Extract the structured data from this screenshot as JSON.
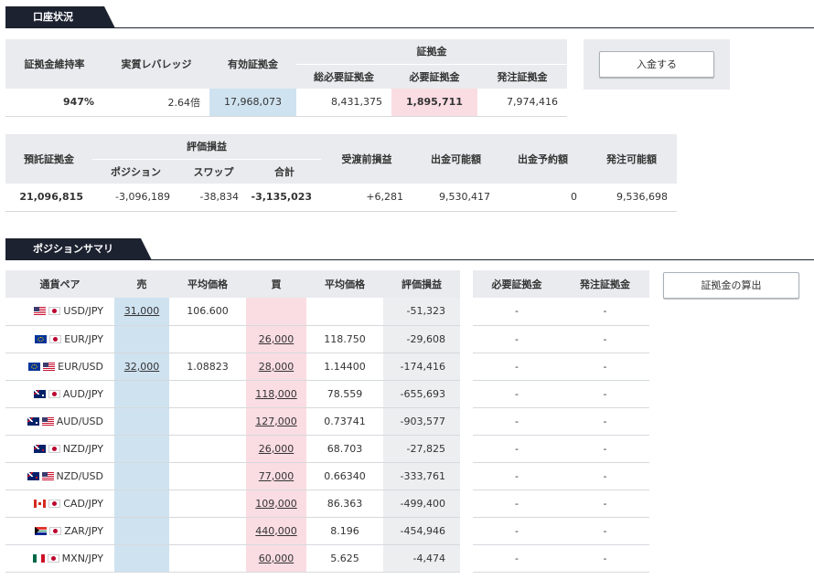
{
  "account": {
    "title": "口座状況",
    "deposit_button": "入金する",
    "table1": {
      "h_margin_ratio": "証拠金維持率",
      "h_leverage": "実質レバレッジ",
      "h_effective": "有効証拠金",
      "h_margin_group": "証拠金",
      "h_total_required": "総必要証拠金",
      "h_required": "必要証拠金",
      "h_order": "発注証拠金",
      "margin_ratio": "947%",
      "leverage": "2.64倍",
      "effective": "17,968,073",
      "total_required": "8,431,375",
      "required": "1,895,711",
      "order": "7,974,416"
    },
    "table2": {
      "h_deposit": "預託証拠金",
      "h_pl_group": "評価損益",
      "h_position": "ポジション",
      "h_swap": "スワップ",
      "h_total": "合計",
      "h_pre_settle": "受渡前損益",
      "h_withdrawable": "出金可能額",
      "h_withdraw_reserved": "出金予約額",
      "h_orderable": "発注可能額",
      "deposit": "21,096,815",
      "position": "-3,096,189",
      "swap": "-38,834",
      "total": "-3,135,023",
      "pre_settle": "+6,281",
      "withdrawable": "9,530,417",
      "withdraw_reserved": "0",
      "orderable": "9,536,698"
    }
  },
  "summary": {
    "title": "ポジションサマリ",
    "calc_button": "証拠金の算出",
    "headers": {
      "pair": "通貨ペア",
      "sell": "売",
      "avg_sell": "平均価格",
      "buy": "買",
      "avg_buy": "平均価格",
      "pl": "評価損益",
      "required": "必要証拠金",
      "order": "発注証拠金"
    },
    "rows": [
      {
        "f1": "f-us",
        "f2": "f-jp",
        "pair": "USD/JPY",
        "sell": "31,000",
        "avg_sell": "106.600",
        "buy": "",
        "avg_buy": "",
        "pl": "-51,323",
        "required": "-",
        "order": "-"
      },
      {
        "f1": "f-eu",
        "f2": "f-jp",
        "pair": "EUR/JPY",
        "sell": "",
        "avg_sell": "",
        "buy": "26,000",
        "avg_buy": "118.750",
        "pl": "-29,608",
        "required": "-",
        "order": "-"
      },
      {
        "f1": "f-eu",
        "f2": "f-us",
        "pair": "EUR/USD",
        "sell": "32,000",
        "avg_sell": "1.08823",
        "buy": "28,000",
        "avg_buy": "1.14400",
        "pl": "-174,416",
        "required": "-",
        "order": "-"
      },
      {
        "f1": "f-au",
        "f2": "f-jp",
        "pair": "AUD/JPY",
        "sell": "",
        "avg_sell": "",
        "buy": "118,000",
        "avg_buy": "78.559",
        "pl": "-655,693",
        "required": "-",
        "order": "-"
      },
      {
        "f1": "f-au",
        "f2": "f-us",
        "pair": "AUD/USD",
        "sell": "",
        "avg_sell": "",
        "buy": "127,000",
        "avg_buy": "0.73741",
        "pl": "-903,577",
        "required": "-",
        "order": "-"
      },
      {
        "f1": "f-nz",
        "f2": "f-jp",
        "pair": "NZD/JPY",
        "sell": "",
        "avg_sell": "",
        "buy": "26,000",
        "avg_buy": "68.703",
        "pl": "-27,825",
        "required": "-",
        "order": "-"
      },
      {
        "f1": "f-nz",
        "f2": "f-us",
        "pair": "NZD/USD",
        "sell": "",
        "avg_sell": "",
        "buy": "77,000",
        "avg_buy": "0.66340",
        "pl": "-333,761",
        "required": "-",
        "order": "-"
      },
      {
        "f1": "f-ca",
        "f2": "f-jp",
        "pair": "CAD/JPY",
        "sell": "",
        "avg_sell": "",
        "buy": "109,000",
        "avg_buy": "86.363",
        "pl": "-499,400",
        "required": "-",
        "order": "-"
      },
      {
        "f1": "f-za",
        "f2": "f-jp",
        "pair": "ZAR/JPY",
        "sell": "",
        "avg_sell": "",
        "buy": "440,000",
        "avg_buy": "8.196",
        "pl": "-454,946",
        "required": "-",
        "order": "-"
      },
      {
        "f1": "f-mx",
        "f2": "f-jp",
        "pair": "MXN/JPY",
        "sell": "",
        "avg_sell": "",
        "buy": "60,000",
        "avg_buy": "5.625",
        "pl": "-4,474",
        "required": "-",
        "order": "-"
      }
    ]
  },
  "colors": {
    "header_bg": "#e9ebee",
    "blue_cell": "#cfe2f0",
    "pink_cell": "#fadde2",
    "title_bg": "#1d2230"
  }
}
